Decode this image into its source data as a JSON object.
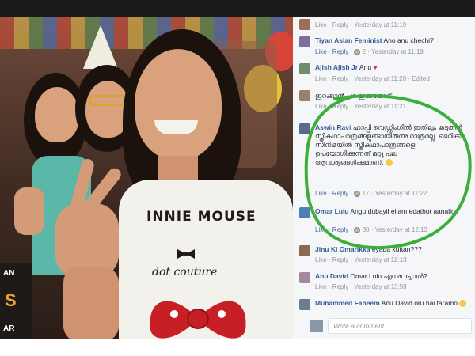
{
  "photo": {
    "shirt_line1": "INNIE MOUSE",
    "shirt_line2": "dot couture",
    "poster_letters": [
      "AN",
      "S",
      "AR"
    ]
  },
  "comments": [
    {
      "author": "",
      "text": "",
      "meta": "Like · Reply · Yesterday at 11:19"
    },
    {
      "author": "Tiyan Aslan Feminist",
      "text": "Ano anu chechi?",
      "meta_like": "Like",
      "meta_reply": "Reply",
      "likes": "2",
      "time": "Yesterday at 11:19"
    },
    {
      "author": "Ajish Ajish Jr",
      "text": "Anu",
      "meta": "Like · Reply · Yesterday at 11:20 · Edited"
    },
    {
      "author": "",
      "text": "ഇറക്കാൻ പറ ഇക്കയോട്.",
      "meta": "Like · Reply · Yesterday at 11:21"
    },
    {
      "author": "Aswin Ravi",
      "text": "ഹാപ്പി വെഡ്ഡിംഗിൽ ഇതിലും കൂടുതൽ സ്ത്രീകഥാപാത്രങ്ങളുണ്ടായിരുന്നു മാത്രമല്ല. മെറിക്ക സിനിമയിൽ സ്ത്രീകഥാപാത്രങ്ങളെ ഉപയോഗിക്കുന്നത് മറ്റു പല ആവശ്യങ്ങൾക്കുമാണ്.",
      "meta_like": "Like",
      "meta_reply": "Reply",
      "likes": "17",
      "time": "Yesterday at 11:22"
    },
    {
      "author": "Omar Lulu",
      "text": "Angu dubayil ellam edathot aanallo",
      "meta_like": "Like",
      "meta_reply": "Reply",
      "likes": "30",
      "time": "Yesterday at 12:13"
    },
    {
      "author": "Jinu Ki Omarikka",
      "text": "eyada kuttan???",
      "meta": "Like · Reply · Yesterday at 12:13"
    },
    {
      "author": "Anu David",
      "text": "Omar Lulu എന്നുവച്ചാൽ?",
      "meta": "Like · Reply · Yesterday at 13:59"
    },
    {
      "author": "Muhammed Faheem",
      "text": "Anu David oru hai taramo",
      "meta": ""
    }
  ],
  "write_comment_placeholder": "Write a comment...",
  "colors": {
    "link": "#365899",
    "highlight_ring": "#3cae3c"
  }
}
